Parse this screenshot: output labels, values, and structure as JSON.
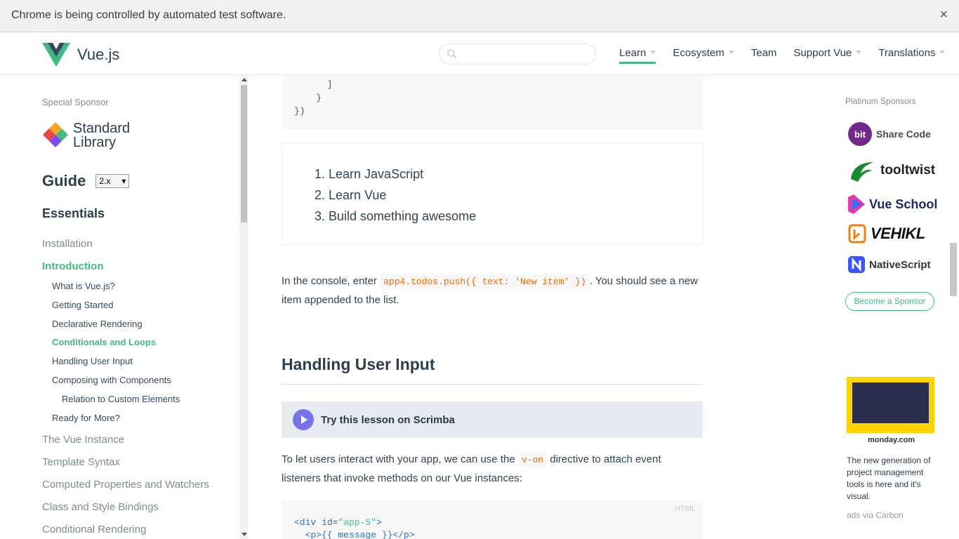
{
  "infobar": {
    "message": "Chrome is being controlled by automated test software.",
    "close": "×"
  },
  "header": {
    "logo_text": "Vue.js",
    "search_placeholder": "",
    "nav": [
      {
        "label": "Learn",
        "dropdown": true,
        "active": true
      },
      {
        "label": "Ecosystem",
        "dropdown": true
      },
      {
        "label": "Team",
        "dropdown": false
      },
      {
        "label": "Support Vue",
        "dropdown": true
      },
      {
        "label": "Translations",
        "dropdown": true
      }
    ]
  },
  "sidebar": {
    "special_sponsor_label": "Special Sponsor",
    "sponsor_name_line1": "Standard",
    "sponsor_name_line2": "Library",
    "guide_title": "Guide",
    "version": "2.x",
    "section_title": "Essentials",
    "items": [
      {
        "label": "Installation",
        "level": "top"
      },
      {
        "label": "Introduction",
        "level": "top",
        "active": true
      },
      {
        "label": "What is Vue.js?",
        "level": "sub"
      },
      {
        "label": "Getting Started",
        "level": "sub"
      },
      {
        "label": "Declarative Rendering",
        "level": "sub"
      },
      {
        "label": "Conditionals and Loops",
        "level": "sub",
        "active": true
      },
      {
        "label": "Handling User Input",
        "level": "sub"
      },
      {
        "label": "Composing with Components",
        "level": "sub"
      },
      {
        "label": "Relation to Custom Elements",
        "level": "subsub"
      },
      {
        "label": "Ready for More?",
        "level": "sub"
      },
      {
        "label": "The Vue Instance",
        "level": "top"
      },
      {
        "label": "Template Syntax",
        "level": "top"
      },
      {
        "label": "Computed Properties and Watchers",
        "level": "top"
      },
      {
        "label": "Class and Style Bindings",
        "level": "top"
      },
      {
        "label": "Conditional Rendering",
        "level": "top"
      }
    ]
  },
  "main": {
    "code_top_lines": [
      "      ]",
      "    }",
      "})"
    ],
    "demo_list": [
      "1. Learn JavaScript",
      "2. Learn Vue",
      "3. Build something awesome"
    ],
    "para1_before": "In the console, enter ",
    "para1_code": "app4.todos.push({ text: 'New item' })",
    "para1_after": ". You should see a new item appended to the list.",
    "heading": "Handling User Input",
    "scrimba_label": "Try this lesson on Scrimba",
    "para2_before": "To let users interact with your app, we can use the ",
    "para2_code": "v-on",
    "para2_after": " directive to attach event listeners that invoke methods on our Vue instances:",
    "code_lang": "HTML",
    "code_line1_tag_open": "<div ",
    "code_line1_attr": "id",
    "code_line1_eq": "=",
    "code_line1_val": "\"app-5\"",
    "code_line1_close": ">",
    "code_line2": "  <p>{{ message }}</p>"
  },
  "sponsors": {
    "label": "Platinum Sponsors",
    "items": [
      {
        "name": "Share Code",
        "icon": "bit-logo",
        "color": "#4a4a4a"
      },
      {
        "name": "tooltwist",
        "icon": "tooltwist-logo",
        "color": "#222222"
      },
      {
        "name": "Vue School",
        "icon": "vueschool-logo",
        "color": "#1a2a6c"
      },
      {
        "name": "VEHIKL",
        "icon": "vehikl-logo",
        "color": "#111111"
      },
      {
        "name": "NativeScript",
        "icon": "nativescript-logo",
        "color": "#333333"
      }
    ],
    "become_label": "Become a Sponsor",
    "carbon_brand": "monday.com",
    "carbon_text": "The new generation of project management tools is here and it's visual.",
    "carbon_via": "ads via Carbon"
  },
  "colors": {
    "accent": "#42b983",
    "text": "#2c3e50",
    "scrimba": "#7774e7"
  }
}
